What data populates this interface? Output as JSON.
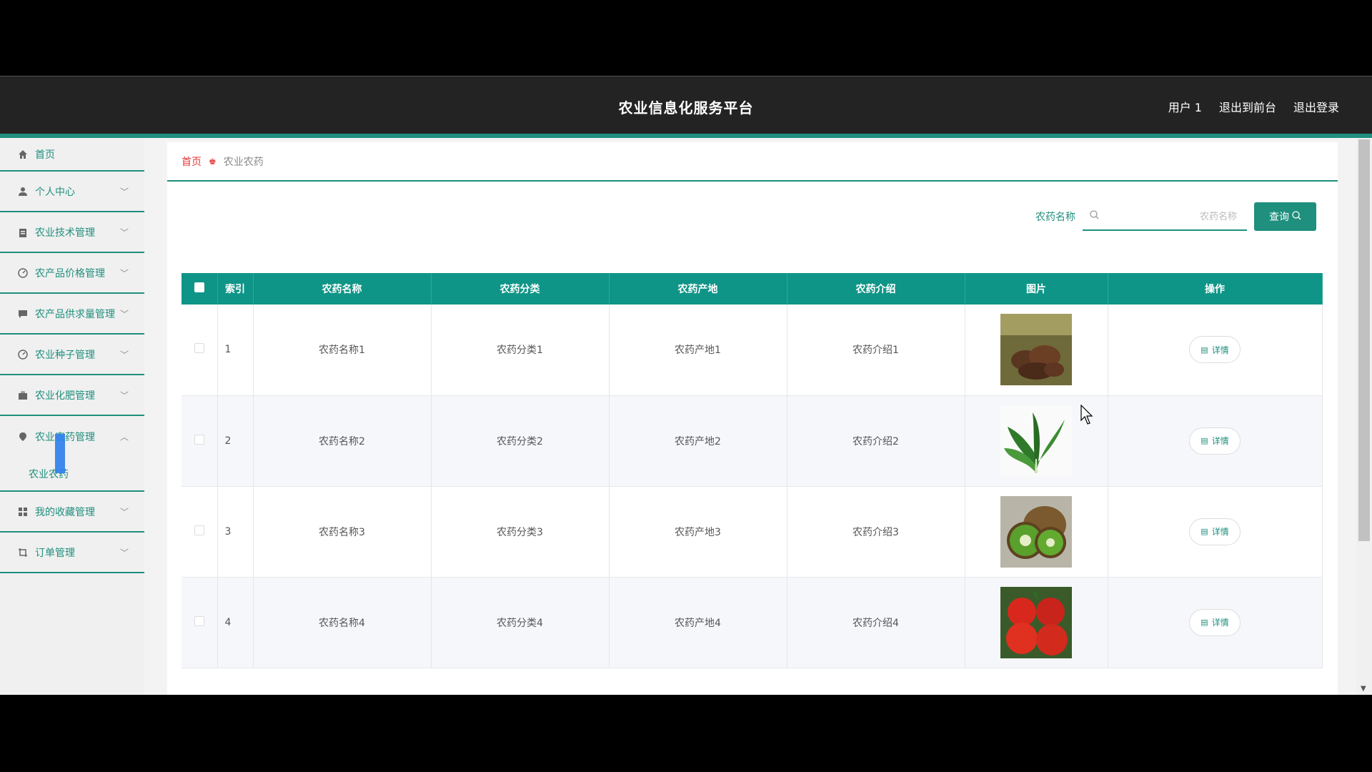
{
  "header": {
    "title": "农业信息化服务平台",
    "nav": [
      "用户 1",
      "退出到前台",
      "退出登录"
    ]
  },
  "sidebar": {
    "items": [
      {
        "label": "首页",
        "icon": "home-icon",
        "expandable": false
      },
      {
        "label": "个人中心",
        "icon": "user-icon",
        "expandable": true
      },
      {
        "label": "农业技术管理",
        "icon": "clipboard-icon",
        "expandable": true
      },
      {
        "label": "农产品价格管理",
        "icon": "gauge-icon",
        "expandable": true
      },
      {
        "label": "农产品供求量管理",
        "icon": "chat-icon",
        "expandable": true
      },
      {
        "label": "农业种子管理",
        "icon": "gauge-icon",
        "expandable": true
      },
      {
        "label": "农业化肥管理",
        "icon": "briefcase-icon",
        "expandable": true
      },
      {
        "label": "农业农药管理",
        "icon": "location-icon",
        "expandable": true,
        "expanded": true,
        "children": [
          "农业农药"
        ]
      },
      {
        "label": "我的收藏管理",
        "icon": "grid-icon",
        "expandable": true
      },
      {
        "label": "订单管理",
        "icon": "crop-icon",
        "expandable": true
      }
    ]
  },
  "breadcrumb": {
    "home": "首页",
    "current": "农业农药"
  },
  "search": {
    "label": "农药名称",
    "placeholder": "农药名称",
    "value": "",
    "button": "查询"
  },
  "table": {
    "columns": [
      "索引",
      "农药名称",
      "农药分类",
      "农药产地",
      "农药介绍",
      "图片",
      "操作"
    ],
    "rows": [
      {
        "index": "1",
        "name": "农药名称1",
        "category": "农药分类1",
        "origin": "农药产地1",
        "intro": "农药介绍1",
        "image": "dried-mushroom-image",
        "action": "详情"
      },
      {
        "index": "2",
        "name": "农药名称2",
        "category": "农药分类2",
        "origin": "农药产地2",
        "intro": "农药介绍2",
        "image": "green-vegetable-image",
        "action": "详情"
      },
      {
        "index": "3",
        "name": "农药名称3",
        "category": "农药分类3",
        "origin": "农药产地3",
        "intro": "农药介绍3",
        "image": "kiwi-fruit-image",
        "action": "详情"
      },
      {
        "index": "4",
        "name": "农药名称4",
        "category": "农药分类4",
        "origin": "农药产地4",
        "intro": "农药介绍4",
        "image": "tomato-image",
        "action": "详情"
      }
    ]
  },
  "colors": {
    "accent": "#1f8f7e",
    "header_bg": "#232323",
    "table_head": "#0f9587",
    "crumb_home": "#e4393c"
  }
}
